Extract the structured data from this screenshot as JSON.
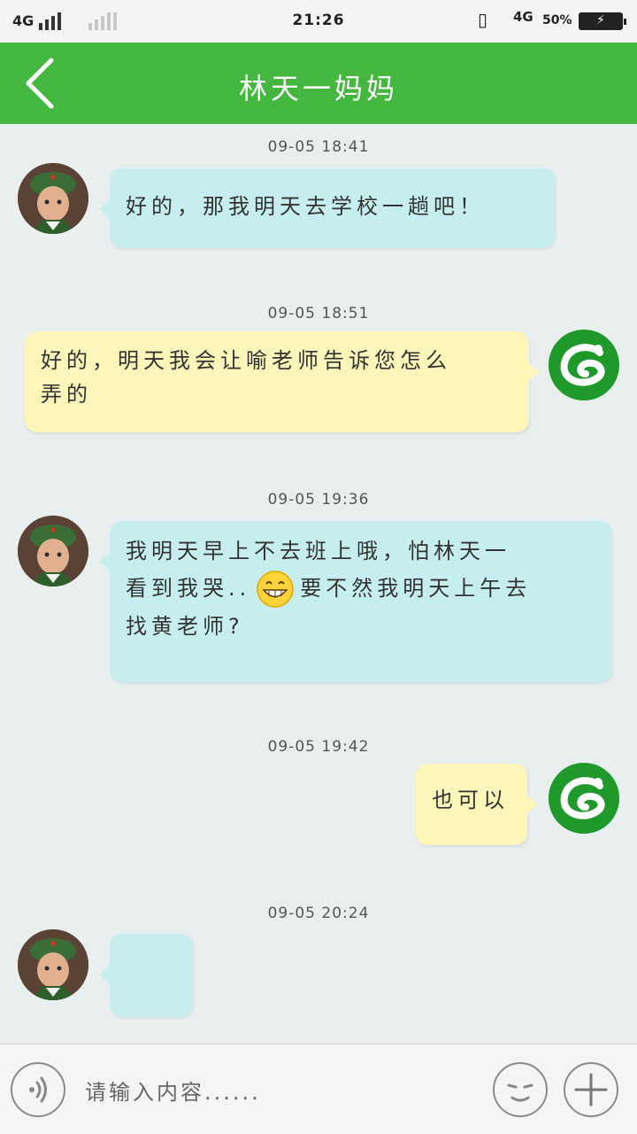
{
  "status_bar": {
    "network_left": "4G",
    "time": "21:26",
    "network_right": "4G",
    "battery_percent": "50%",
    "battery_icon": "battery-charging-icon"
  },
  "header": {
    "title": "林天一妈妈",
    "back_icon": "chevron-left-icon"
  },
  "messages": [
    {
      "timestamp": "09-05 18:41",
      "side": "left",
      "text": "好的，那我明天去学校一趟吧！"
    },
    {
      "timestamp": "09-05 18:51",
      "side": "right",
      "line1": "好的，明天我会让喻老师告诉您怎么",
      "line2": "弄的"
    },
    {
      "timestamp": "09-05 19:36",
      "side": "left",
      "line1": "我明天早上不去班上哦，怕林天一",
      "line2a": "看到我哭..",
      "emoji": "grinning-face-icon",
      "line2b": "要不然我明天上午去",
      "line3": "找黄老师?"
    },
    {
      "timestamp": "09-05 19:42",
      "side": "right",
      "text": "也可以"
    },
    {
      "timestamp": "09-05 20:24",
      "side": "left",
      "text": ""
    }
  ],
  "input_bar": {
    "voice_icon": "voice-icon",
    "placeholder": "请输入内容......",
    "emoji_icon": "emoji-face-icon",
    "add_icon": "plus-icon"
  },
  "colors": {
    "header": "#43b73e",
    "left_bubble": "#c7eeee",
    "right_bubble": "#fdf6ba",
    "background": "#e9eeee"
  }
}
